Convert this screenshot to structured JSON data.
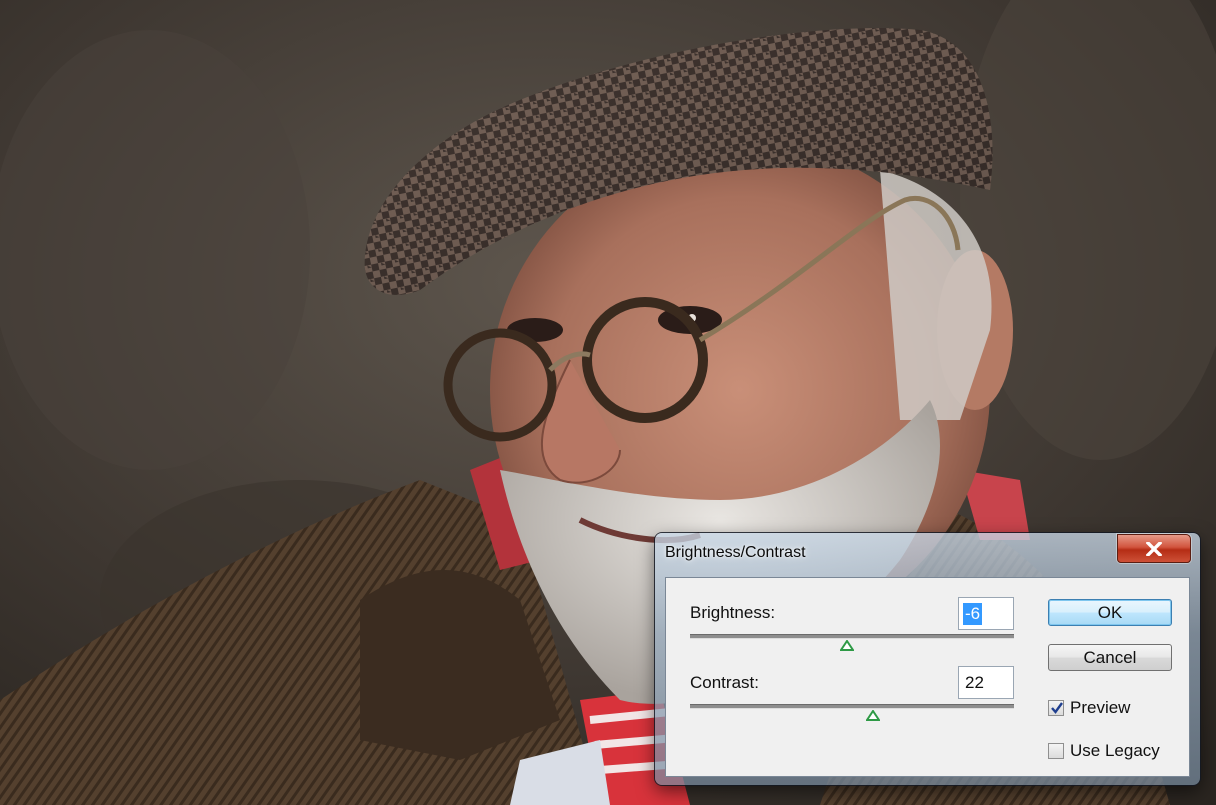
{
  "dialog": {
    "title": "Brightness/Contrast",
    "close_glyph": "✕",
    "brightness": {
      "label": "Brightness:",
      "value": "-6",
      "slider_fraction": 0.485
    },
    "contrast": {
      "label": "Contrast:",
      "value": "22",
      "slider_fraction": 0.565
    },
    "buttons": {
      "ok": "OK",
      "cancel": "Cancel"
    },
    "checkboxes": {
      "preview": {
        "label": "Preview",
        "checked": true
      },
      "use_legacy": {
        "label": "Use Legacy",
        "checked": false
      }
    }
  },
  "colors": {
    "slider_thumb": "#2e9a46",
    "close_button": "#c9442c",
    "selection": "#3399ff"
  }
}
